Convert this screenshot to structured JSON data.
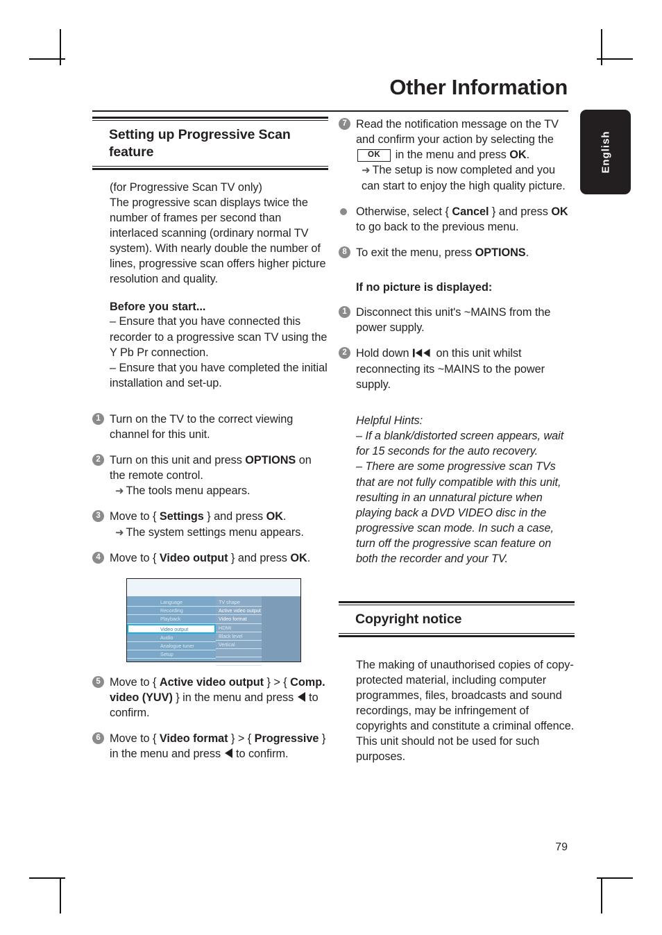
{
  "header": {
    "title": "Other Information",
    "language_tab": "English"
  },
  "page_number": "79",
  "left_column": {
    "section_title": "Setting up Progressive Scan feature",
    "intro": "(for Progressive Scan TV only)",
    "intro_body": "The progressive scan displays twice the number of frames per second than interlaced scanning (ordinary normal TV system). With nearly double the number of lines, progressive scan offers higher picture resolution and quality.",
    "before_heading": "Before you start...",
    "before_line1": "– Ensure that you have connected this recorder to a progressive scan TV using the Y Pb Pr connection.",
    "before_line2": "– Ensure that you have completed the initial installation and set-up.",
    "steps": [
      {
        "num": "1",
        "text": "Turn on the TV to the correct viewing channel for this unit."
      },
      {
        "num": "2",
        "text_a": "Turn on this unit and press ",
        "bold_a": "OPTIONS",
        "text_b": " on the remote control.",
        "result": "The tools menu appears."
      },
      {
        "num": "3",
        "text_a": "Move to { ",
        "bold_a": "Settings",
        "text_b": " } and press ",
        "bold_b": "OK",
        "text_c": ".",
        "result": "The system settings menu appears."
      },
      {
        "num": "4",
        "text_a": "Move to { ",
        "bold_a": "Video output",
        "text_b": " } and press ",
        "bold_b": "OK",
        "text_c": "."
      },
      {
        "num": "5",
        "text_a": "Move to { ",
        "bold_a": "Active video output",
        "text_b": " } > { ",
        "bold_b": "Comp. video (YUV)",
        "text_c": " } in the menu and press ",
        "text_d": " to confirm."
      },
      {
        "num": "6",
        "text_a": "Move to { ",
        "bold_a": "Video format",
        "text_b": " } > { ",
        "bold_b": "Progressive",
        "text_c": " } in the menu and press ",
        "text_d": " to confirm."
      }
    ],
    "osd_screenshot": {
      "accent_color": "#16b2e6",
      "panel_color": "#7ba7c9",
      "titlebar_color": "#eef5fa",
      "left_menu": [
        {
          "label": "Language",
          "state": "dim"
        },
        {
          "label": "Recording",
          "state": "dim"
        },
        {
          "label": "Playback",
          "state": "dim"
        },
        {
          "label": "Video output",
          "state": "selected"
        },
        {
          "label": "Audio",
          "state": "dim"
        },
        {
          "label": "Analogue tuner",
          "state": "dim"
        },
        {
          "label": "Setup",
          "state": "dim"
        }
      ],
      "right_menu": [
        {
          "label": "TV shape",
          "state": "dim"
        },
        {
          "label": "Active video output",
          "state": "bright"
        },
        {
          "label": "Video format",
          "state": "bright"
        },
        {
          "label": "HDMI",
          "state": "dim"
        },
        {
          "label": "Black level",
          "state": "dim"
        },
        {
          "label": "Vertical",
          "state": "dim"
        },
        {
          "label": "",
          "state": "blank"
        },
        {
          "label": "",
          "state": "blank"
        }
      ]
    }
  },
  "right_column": {
    "steps": [
      {
        "num": "7",
        "text_a": "Read the notification message on the TV and confirm your action by selecting the ",
        "key_label": "OK",
        "text_b": " in the menu and press ",
        "bold_b": "OK",
        "text_c": ".",
        "result": "The setup is now completed and you can start to enjoy the high quality picture."
      },
      {
        "num": "•",
        "text_a": "Otherwise, select { ",
        "bold_a": "Cancel",
        "text_b": " } and press ",
        "bold_b": "OK",
        "text_c": " to go back to the previous menu."
      },
      {
        "num": "8",
        "text_a": "To exit the menu, press ",
        "bold_a": "OPTIONS",
        "text_b": "."
      }
    ],
    "no_picture_heading": "If no picture is displayed:",
    "no_picture_steps": [
      {
        "num": "1",
        "text": "Disconnect this unit's ~MAINS from the power supply."
      },
      {
        "num": "2",
        "text_a": "Hold down ",
        "text_b": " on this unit whilst reconnecting its ~MAINS to the power supply."
      }
    ],
    "hints_heading": "Helpful Hints:",
    "hint_1": "– If a blank/distorted screen appears, wait for 15 seconds for the auto recovery.",
    "hint_2": "– There are some progressive scan TVs that are not fully compatible with this unit, resulting in an unnatural picture when playing back a DVD VIDEO disc in the progressive scan mode. In such a case, turn off the progressive scan feature on both the recorder and your TV.",
    "copyright_title": "Copyright notice",
    "copyright_body": "The making of unauthorised copies of copy-protected material, including computer programmes, files, broadcasts and sound recordings, may be infringement of copyrights and constitute a criminal offence.  This unit should not be used for such purposes."
  }
}
